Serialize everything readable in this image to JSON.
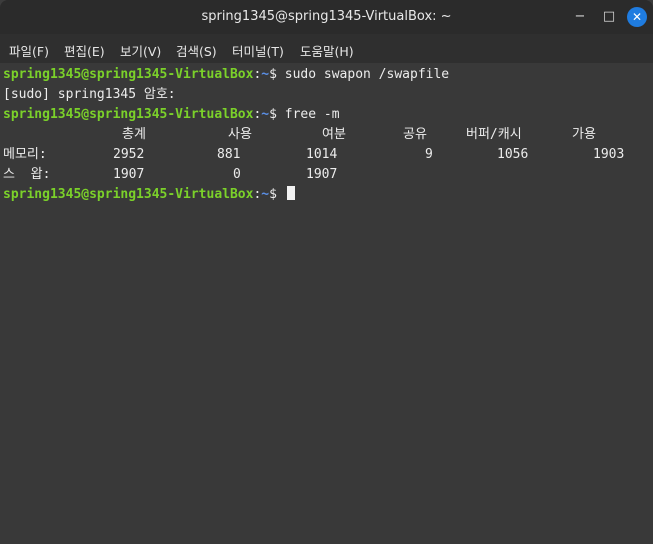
{
  "window": {
    "title": "spring1345@spring1345-VirtualBox: ~",
    "minimize_glyph": "−",
    "maximize_glyph": "□",
    "close_glyph": "✕"
  },
  "menu": {
    "items": [
      "파일(F)",
      "편집(E)",
      "보기(V)",
      "검색(S)",
      "터미널(T)",
      "도움말(H)"
    ]
  },
  "terminal": {
    "line1": {
      "prompt": "spring1345@spring1345-VirtualBox",
      "sep": ":",
      "path": "~",
      "dollar": "$",
      "command": " sudo swapon /swapfile"
    },
    "line2": "[sudo] spring1345 암호:",
    "line3": {
      "prompt": "spring1345@spring1345-VirtualBox",
      "sep": ":",
      "path": "~",
      "dollar": "$",
      "command": " free -m"
    },
    "table": {
      "headers": [
        "총계",
        "사용",
        "여분",
        "공유",
        "버퍼/캐시",
        "가용"
      ],
      "rows": [
        {
          "label": "메모리:",
          "values": [
            "2952",
            "881",
            "1014",
            "9",
            "1056",
            "1903"
          ]
        },
        {
          "label": "스  왑:",
          "values": [
            "1907",
            "0",
            "1907",
            "",
            "",
            ""
          ]
        }
      ]
    },
    "line6": {
      "prompt": "spring1345@spring1345-VirtualBox",
      "sep": ":",
      "path": "~",
      "dollar": "$",
      "command": " "
    }
  },
  "colors": {
    "prompt": "#7bd12a",
    "close_button": "#1f7ce0",
    "background": "#393939"
  }
}
